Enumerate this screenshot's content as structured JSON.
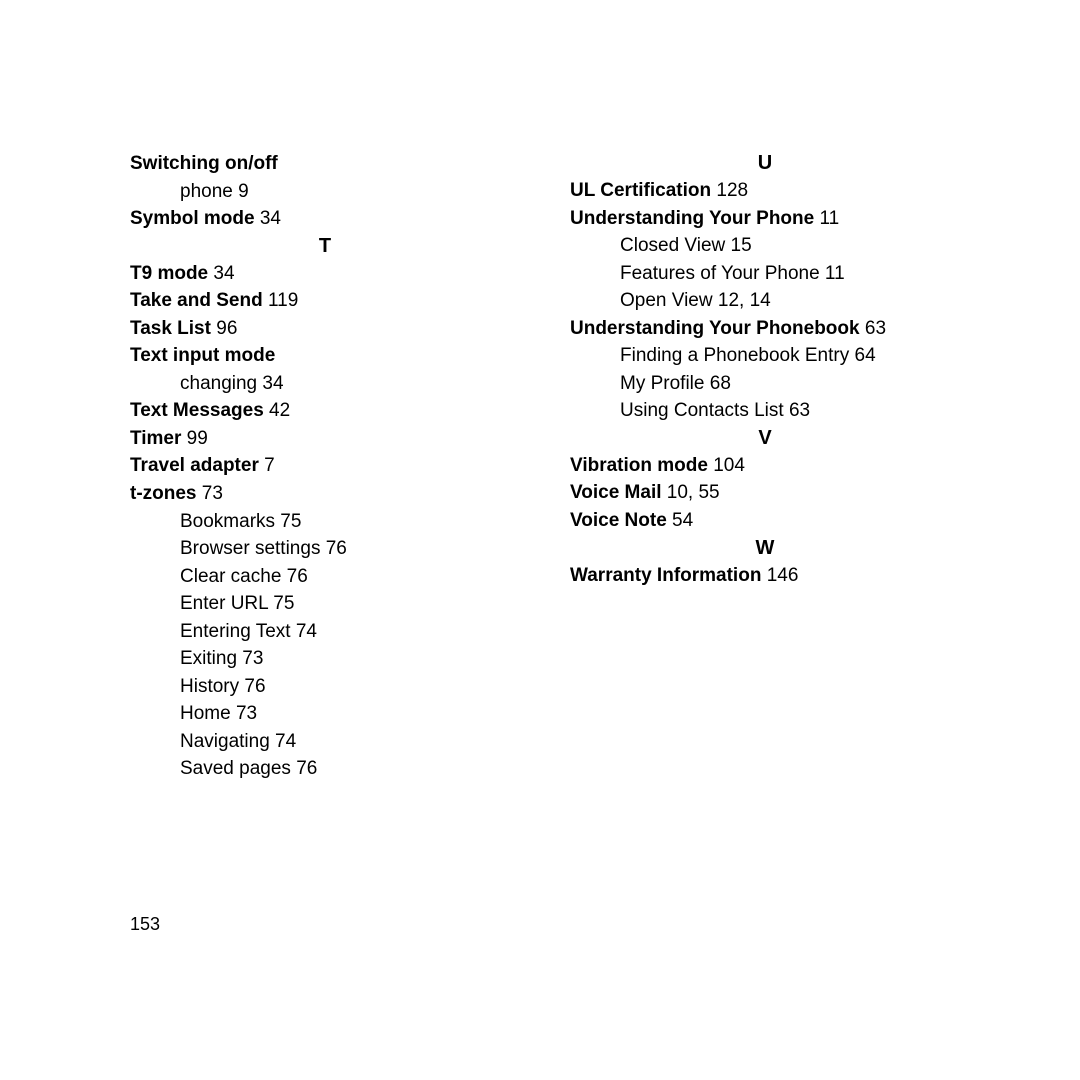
{
  "page_number": "153",
  "left_column": [
    {
      "type": "entry",
      "bold": "Switching on/off",
      "page": ""
    },
    {
      "type": "sub",
      "text": "phone",
      "page": "9"
    },
    {
      "type": "entry",
      "bold": "Symbol mode",
      "page": "34"
    },
    {
      "type": "header",
      "text": "T"
    },
    {
      "type": "entry",
      "bold": "T9 mode",
      "page": "34"
    },
    {
      "type": "entry",
      "bold": "Take and Send",
      "page": "119"
    },
    {
      "type": "entry",
      "bold": "Task List",
      "page": "96"
    },
    {
      "type": "entry",
      "bold": "Text input mode",
      "page": ""
    },
    {
      "type": "sub",
      "text": "changing",
      "page": "34"
    },
    {
      "type": "entry",
      "bold": "Text Messages",
      "page": "42"
    },
    {
      "type": "entry",
      "bold": "Timer",
      "page": "99"
    },
    {
      "type": "entry",
      "bold": "Travel adapter",
      "page": "7"
    },
    {
      "type": "entry",
      "bold": "t-zones",
      "page": "73"
    },
    {
      "type": "sub",
      "text": "Bookmarks",
      "page": "75"
    },
    {
      "type": "sub",
      "text": "Browser settings",
      "page": "76"
    },
    {
      "type": "sub",
      "text": "Clear cache",
      "page": "76"
    },
    {
      "type": "sub",
      "text": "Enter URL",
      "page": "75"
    },
    {
      "type": "sub",
      "text": "Entering Text",
      "page": "74"
    },
    {
      "type": "sub",
      "text": "Exiting",
      "page": "73"
    },
    {
      "type": "sub",
      "text": "History",
      "page": "76"
    },
    {
      "type": "sub",
      "text": "Home",
      "page": "73"
    },
    {
      "type": "sub",
      "text": "Navigating",
      "page": "74"
    },
    {
      "type": "sub",
      "text": "Saved pages",
      "page": "76"
    }
  ],
  "right_column": [
    {
      "type": "header",
      "text": "U"
    },
    {
      "type": "entry",
      "bold": "UL Certification",
      "page": "128"
    },
    {
      "type": "entry",
      "bold": "Understanding Your Phone",
      "page": "11"
    },
    {
      "type": "sub",
      "text": "Closed View",
      "page": "15"
    },
    {
      "type": "sub",
      "text": "Features of Your Phone",
      "page": "11"
    },
    {
      "type": "sub",
      "text": "Open View",
      "page": "12, 14"
    },
    {
      "type": "entry",
      "bold": "Understanding Your Phonebook",
      "page": "63"
    },
    {
      "type": "sub",
      "text": "Finding a Phonebook Entry",
      "page": "64"
    },
    {
      "type": "sub",
      "text": "My Profile",
      "page": "68"
    },
    {
      "type": "sub",
      "text": "Using Contacts List",
      "page": "63"
    },
    {
      "type": "header",
      "text": "V"
    },
    {
      "type": "entry",
      "bold": "Vibration mode",
      "page": "104"
    },
    {
      "type": "entry",
      "bold": "Voice Mail",
      "page": "10, 55"
    },
    {
      "type": "entry",
      "bold": "Voice Note",
      "page": "54"
    },
    {
      "type": "header",
      "text": "W"
    },
    {
      "type": "entry",
      "bold": "Warranty Information",
      "page": "146"
    }
  ]
}
